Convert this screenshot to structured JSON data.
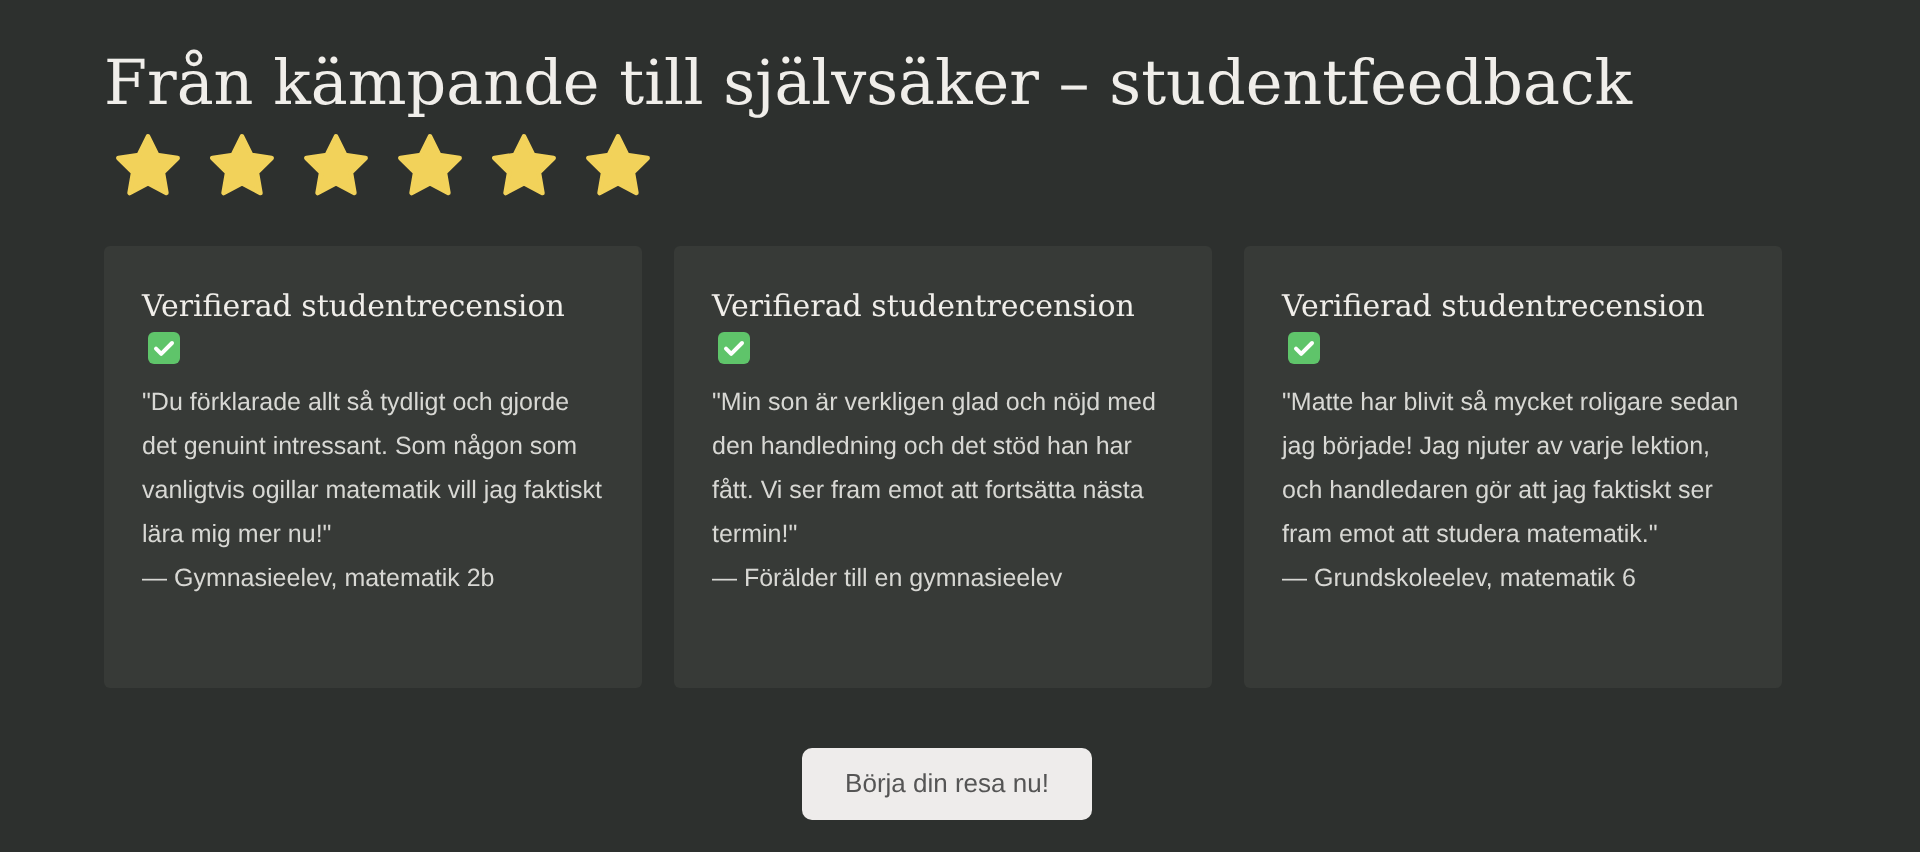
{
  "heading": "Från kämpande till självsäker – studentfeedback",
  "rating": {
    "stars": 6
  },
  "reviews": [
    {
      "title": "Verifierad studentrecension",
      "verified": true,
      "quote": "\"Du förklarade allt så tydligt och gjorde det genuint intressant. Som någon som vanligtvis ogillar matematik vill jag faktiskt lära mig mer nu!\"",
      "author": "— Gymnasieelev, matematik 2b"
    },
    {
      "title": "Verifierad studentrecension",
      "verified": true,
      "quote": "\"Min son är verkligen glad och nöjd med den handledning och det stöd han har fått. Vi ser fram emot att fortsätta nästa termin!\"",
      "author": "— Förälder till en gymnasieelev"
    },
    {
      "title": "Verifierad studentrecension",
      "verified": true,
      "quote": "\"Matte har blivit så mycket roligare sedan jag började! Jag njuter av varje lektion, och handledaren gör att jag faktiskt ser fram emot att studera matematik.\"",
      "author": "— Grundskoleelev, matematik 6"
    }
  ],
  "cta": {
    "label": "Börja din resa nu!"
  }
}
